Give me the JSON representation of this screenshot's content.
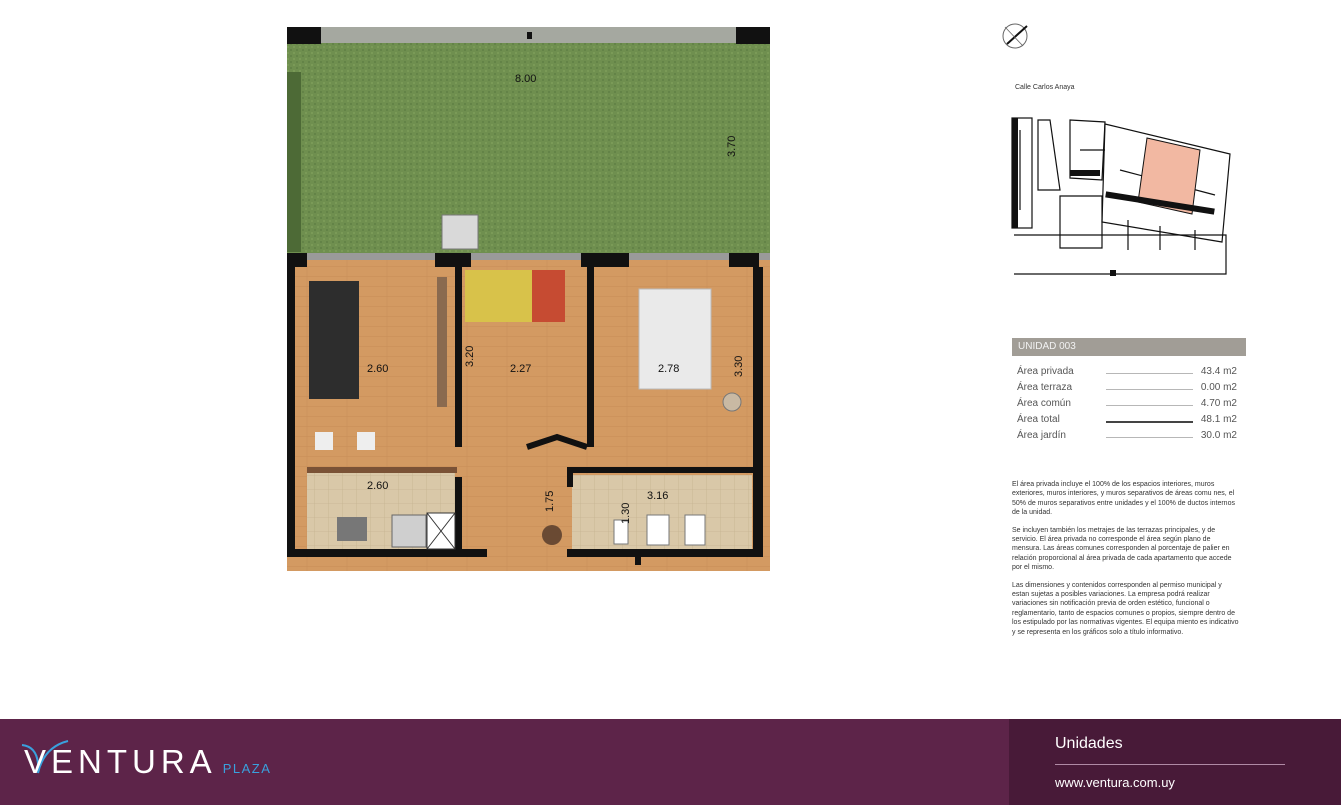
{
  "plan": {
    "dimensions": {
      "garden_width": "8.00",
      "garden_depth": "3.70",
      "living_width": "2.60",
      "bedroom1_width": "2.27",
      "bedroom1_depth": "3.20",
      "bedroom2_width": "2.78",
      "bedroom2_depth": "3.30",
      "kitchen_width": "2.60",
      "bath_width": "3.16",
      "bath_depth": "1.30",
      "hall_depth": "1.75"
    }
  },
  "site": {
    "street": "Calle Carlos Anaya",
    "highlight_color": "#f2b8a2"
  },
  "unit": {
    "title": "UNIDAD 003",
    "areas": [
      {
        "label": "Área privada",
        "value": "43.4 m2",
        "total": false
      },
      {
        "label": "Área terraza",
        "value": "0.00 m2",
        "total": false
      },
      {
        "label": "Área común",
        "value": "4.70 m2",
        "total": false
      },
      {
        "label": "Área total",
        "value": "48.1 m2",
        "total": true
      },
      {
        "label": "Área jardín",
        "value": "30.0 m2",
        "total": false
      }
    ]
  },
  "notes": {
    "p1": "El área privada incluye el 100% de los espacios interiores, muros exteriores, muros interiores, y muros separativos de áreas comu nes, el 50% de muros separativos entre unidades y el 100% de ductos internos de la unidad.",
    "p2": "Se incluyen también los metrajes de las terrazas principales, y de servicio. El área privada no corresponde el área según plano de mensura. Las áreas comunes corresponden al porcentaje de palier en relación proporcional al área privada de cada apartamento que accede por el mismo.",
    "p3": "Las dimensiones y contenidos corresponden al permiso municipal y estan sujetas a posibles variaciones. La empresa podrá realizar variaciones sin notificación previa de orden estético, funcional o reglamentario, tanto de espacios comunes o propios, siempre dentro de los estipulado por las normativas vigentes. El equipa miento es indicativo y se representa en los gráficos solo a título informativo."
  },
  "footer": {
    "brand": "VENTURA",
    "brand_sub": "PLAZA",
    "section": "Unidades",
    "url": "www.ventura.com.uy",
    "colors": {
      "bg": "#5d2449",
      "panel": "#481a38",
      "accent": "#3aa0dd"
    }
  }
}
